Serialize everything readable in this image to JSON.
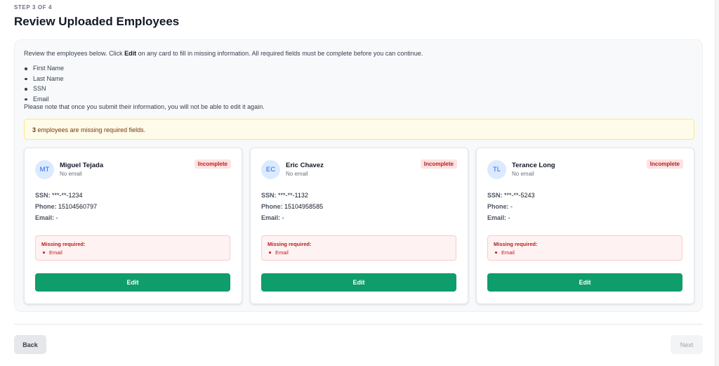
{
  "step": "STEP 3 OF 4",
  "title": "Review Uploaded Employees",
  "intro": {
    "before": "Review the employees below. Click ",
    "bold": "Edit",
    "after": " on any card to fill in missing information. All required fields must be complete before you can continue."
  },
  "required_fields": [
    "First Name",
    "Last Name",
    "SSN",
    "Email"
  ],
  "note": "Please note that once you submit their information, you will not be able to edit it again.",
  "alert": {
    "count": "3",
    "text": " employees are missing required fields."
  },
  "labels": {
    "ssn": "SSN:",
    "phone": "Phone:",
    "email": "Email:",
    "missing_required": "Missing required:",
    "edit": "Edit"
  },
  "employees": [
    {
      "initials": "MT",
      "name": "Miguel Tejada",
      "email_sub": "No email",
      "status": "Incomplete",
      "ssn": "***-**-1234",
      "phone": "15104560797",
      "email": "-",
      "missing": [
        "Email"
      ]
    },
    {
      "initials": "EC",
      "name": "Eric Chavez",
      "email_sub": "No email",
      "status": "Incomplete",
      "ssn": "***-**-1132",
      "phone": "15104958585",
      "email": "-",
      "missing": [
        "Email"
      ]
    },
    {
      "initials": "TL",
      "name": "Terance Long",
      "email_sub": "No email",
      "status": "Incomplete",
      "ssn": "***-**-5243",
      "phone": "-",
      "email": "-",
      "missing": [
        "Email"
      ]
    }
  ],
  "footer": {
    "back": "Back",
    "next": "Next"
  },
  "colors": {
    "primary": "#0f9d6b",
    "badge_bg": "#fee2e2",
    "badge_text": "#b91c1c",
    "alert_bg": "#fefce8",
    "avatar_bg": "#dbeafe"
  }
}
